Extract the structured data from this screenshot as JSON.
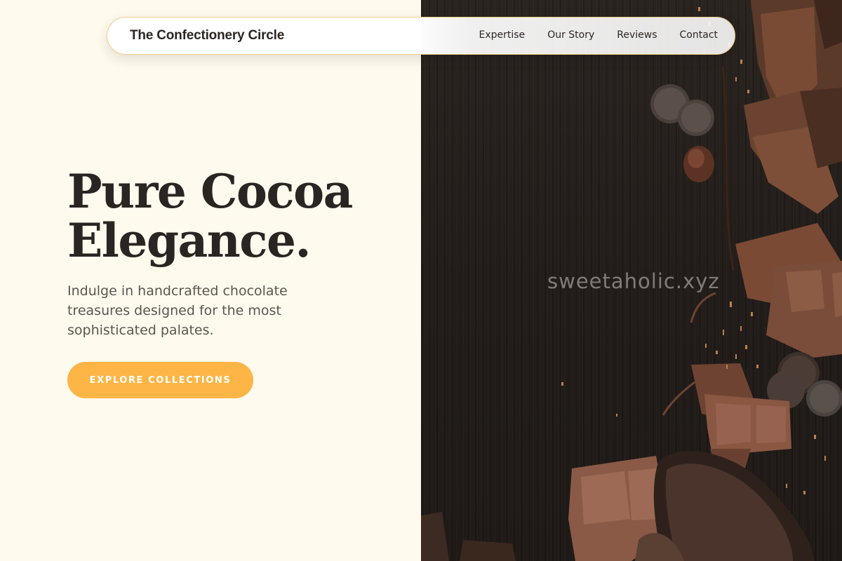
{
  "header": {
    "brand": "The Confectionery Circle",
    "nav": [
      {
        "label": "Expertise"
      },
      {
        "label": "Our Story"
      },
      {
        "label": "Reviews"
      },
      {
        "label": "Contact"
      }
    ]
  },
  "hero": {
    "title_line1": "Pure Cocoa",
    "title_line2": "Elegance.",
    "subtitle": "Indulge in handcrafted chocolate treasures designed for the most sophisticated palates.",
    "cta_label": "EXPLORE COLLECTIONS"
  },
  "image": {
    "watermark": "sweetaholic.xyz"
  },
  "colors": {
    "background": "#fffaee",
    "accent": "#fdb545",
    "text_dark": "#2a2522",
    "text_muted": "#5d5450",
    "nav_border": "#eccf8d"
  }
}
